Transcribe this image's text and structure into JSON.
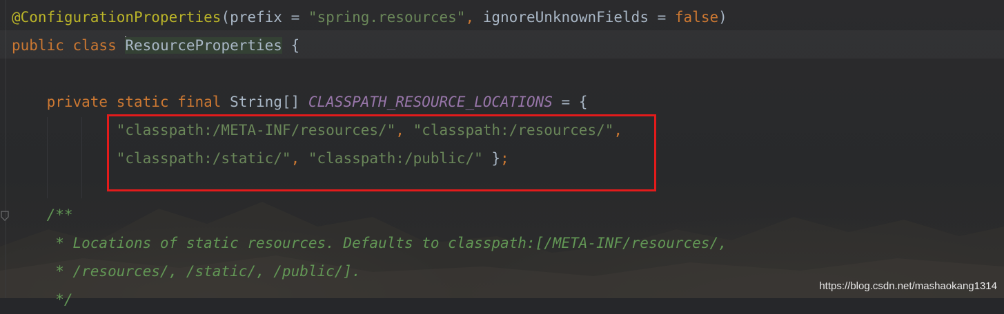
{
  "editor": {
    "lines": [
      {
        "tokens": [
          {
            "text": "@ConfigurationProperties",
            "cls": "ann"
          },
          {
            "text": "(prefix = ",
            "cls": "plain"
          },
          {
            "text": "\"spring.resources\"",
            "cls": "str"
          },
          {
            "text": ", ",
            "cls": "kw"
          },
          {
            "text": "ignoreUnknownFields = ",
            "cls": "plain"
          },
          {
            "text": "false",
            "cls": "kw"
          },
          {
            "text": ")",
            "cls": "plain"
          }
        ]
      },
      {
        "tokens": [
          {
            "text": "public class ",
            "cls": "kw"
          },
          {
            "text": "ResourceProperties",
            "cls": "plain ident-hl",
            "caret": true
          },
          {
            "text": " {",
            "cls": "plain"
          }
        ]
      },
      {
        "tokens": []
      },
      {
        "tokens": [
          {
            "text": "    private static final ",
            "cls": "kw"
          },
          {
            "text": "String[] ",
            "cls": "plain"
          },
          {
            "text": "CLASSPATH_RESOURCE_LOCATIONS",
            "cls": "const"
          },
          {
            "text": " = {",
            "cls": "plain"
          }
        ]
      },
      {
        "tokens": [
          {
            "text": "            \"classpath:/META-INF/resources/\"",
            "cls": "str"
          },
          {
            "text": ", ",
            "cls": "kw"
          },
          {
            "text": "\"classpath:/resources/\"",
            "cls": "str"
          },
          {
            "text": ",",
            "cls": "kw"
          }
        ]
      },
      {
        "tokens": [
          {
            "text": "            \"classpath:/static/\"",
            "cls": "str"
          },
          {
            "text": ", ",
            "cls": "kw"
          },
          {
            "text": "\"classpath:/public/\"",
            "cls": "str"
          },
          {
            "text": " }",
            "cls": "plain"
          },
          {
            "text": ";",
            "cls": "kw"
          }
        ]
      },
      {
        "tokens": []
      },
      {
        "tokens": [
          {
            "text": "    /**",
            "cls": "doc"
          }
        ]
      },
      {
        "tokens": [
          {
            "text": "     * Locations of static resources. Defaults to classpath:[/META-INF/resources/,",
            "cls": "doc"
          }
        ]
      },
      {
        "tokens": [
          {
            "text": "     * /resources/, /static/, /public/].",
            "cls": "doc"
          }
        ]
      },
      {
        "tokens": [
          {
            "text": "     */",
            "cls": "doc"
          }
        ]
      }
    ]
  },
  "watermark": "https://blog.csdn.net/mashaokang1314"
}
